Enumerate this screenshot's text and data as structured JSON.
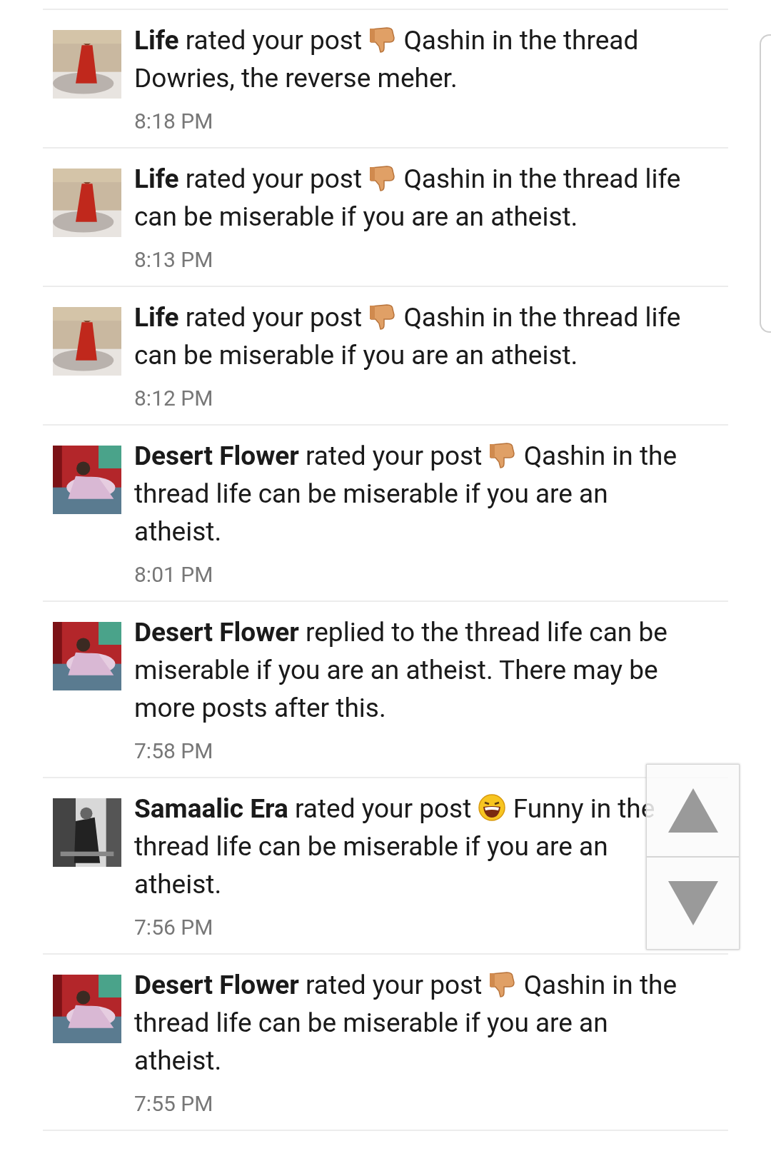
{
  "notifications": [
    {
      "user": "Life",
      "action": "rated your post",
      "rating": {
        "kind": "dislike",
        "label": "Qashin"
      },
      "rest": "in the thread Dowries, the reverse meher.",
      "time": "8:18 PM"
    },
    {
      "user": "Life",
      "action": "rated your post",
      "rating": {
        "kind": "dislike",
        "label": "Qashin"
      },
      "rest": "in the thread life can be miserable if you are an atheist.",
      "time": "8:13 PM"
    },
    {
      "user": "Life",
      "action": "rated your post",
      "rating": {
        "kind": "dislike",
        "label": "Qashin"
      },
      "rest": "in the thread life can be miserable if you are an atheist.",
      "time": "8:12 PM"
    },
    {
      "user": "Desert Flower",
      "action": "rated your post",
      "rating": {
        "kind": "dislike",
        "label": "Qashin"
      },
      "rest": "in the thread life can be miserable if you are an atheist.",
      "time": "8:01 PM"
    },
    {
      "user": "Desert Flower",
      "action": "replied to the thread life can be miserable if you are an atheist. There may be more posts after this.",
      "time": "7:58 PM"
    },
    {
      "user": "Samaalic Era",
      "action": "rated your post",
      "rating": {
        "kind": "funny",
        "label": "Funny"
      },
      "rest": "in the thread life can be miserable if you are an atheist.",
      "time": "7:56 PM"
    },
    {
      "user": "Desert Flower",
      "action": "rated your post",
      "rating": {
        "kind": "dislike",
        "label": "Qashin"
      },
      "rest": "in the thread life can be miserable if you are an atheist.",
      "time": "7:55 PM"
    }
  ]
}
